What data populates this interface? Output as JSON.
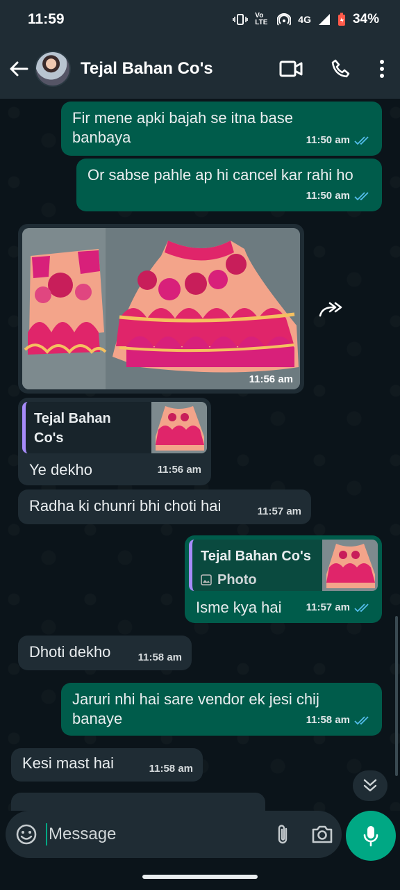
{
  "status_bar": {
    "time": "11:59",
    "network": "4G",
    "volte": "Vo LTE",
    "battery": "34%"
  },
  "header": {
    "contact_name": "Tejal Bahan Co's"
  },
  "messages": [
    {
      "direction": "out",
      "text": "Fir mene apki bajah se itna base banbaya",
      "time": "11:50 am"
    },
    {
      "direction": "out",
      "text": "Or sabse pahle ap hi cancel kar rahi ho",
      "time": "11:50 am"
    },
    {
      "direction": "in",
      "type": "photo",
      "time": "11:56 am"
    },
    {
      "direction": "in",
      "quote_author": "Tejal Bahan Co's",
      "quote_type": "Photo",
      "text": "Ye dekho",
      "time": "11:56 am"
    },
    {
      "direction": "in",
      "text": "Radha ki chunri bhi choti hai",
      "time": "11:57 am"
    },
    {
      "direction": "out",
      "quote_author": "Tejal Bahan Co's",
      "quote_type": "Photo",
      "text": "Isme kya hai",
      "time": "11:57 am"
    },
    {
      "direction": "in",
      "text": "Dhoti dekho",
      "time": "11:58 am"
    },
    {
      "direction": "out",
      "text": "Jaruri nhi hai sare vendor ek jesi chij banaye",
      "time": "11:58 am"
    },
    {
      "direction": "in",
      "text": "Kesi mast hai",
      "time": "11:58 am"
    }
  ],
  "input": {
    "placeholder": "Message"
  },
  "icons": {
    "back": "back-arrow-icon",
    "video": "video-call-icon",
    "voice": "voice-call-icon",
    "menu": "more-vert-icon",
    "emoji": "emoji-icon",
    "attach": "paperclip-icon",
    "camera": "camera-icon",
    "mic": "mic-icon",
    "forward": "forward-icon",
    "scroll": "double-chevron-down-icon"
  },
  "colors": {
    "outgoing_bubble": "#005c4b",
    "incoming_bubble": "#1f2c34",
    "accent": "#00a884",
    "read_ticks": "#53bdeb"
  }
}
